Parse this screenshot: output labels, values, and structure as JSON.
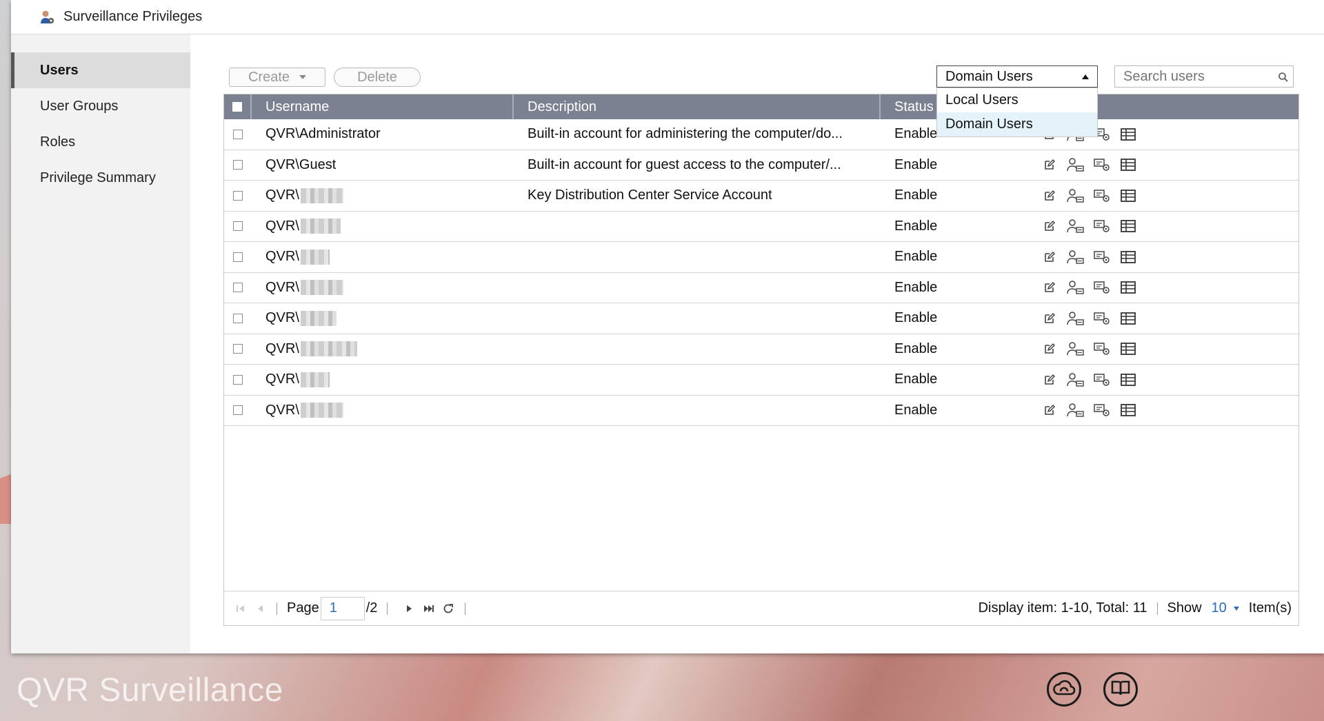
{
  "window": {
    "title": "Surveillance Privileges"
  },
  "sidebar": {
    "items": [
      {
        "label": "Users",
        "active": true
      },
      {
        "label": "User Groups"
      },
      {
        "label": "Roles"
      },
      {
        "label": "Privilege Summary"
      }
    ]
  },
  "toolbar": {
    "create_label": "Create",
    "delete_label": "Delete"
  },
  "filter": {
    "selected": "Domain Users",
    "options": [
      "Local Users",
      "Domain Users"
    ]
  },
  "search": {
    "placeholder": "Search users"
  },
  "table": {
    "columns": [
      "Username",
      "Description",
      "Status"
    ],
    "rows": [
      {
        "username": "QVR\\Administrator",
        "description": "Built-in account for administering the computer/do...",
        "status": "Enable"
      },
      {
        "username": "QVR\\Guest",
        "description": "Built-in account for guest access to the computer/...",
        "status": "Enable"
      },
      {
        "username": "QVR\\",
        "description": "Key Distribution Center Service Account",
        "status": "Enable"
      },
      {
        "username": "QVR\\",
        "description": "",
        "status": "Enable"
      },
      {
        "username": "QVR\\",
        "description": "",
        "status": "Enable"
      },
      {
        "username": "QVR\\",
        "description": "",
        "status": "Enable"
      },
      {
        "username": "QVR\\",
        "description": "",
        "status": "Enable"
      },
      {
        "username": "QVR\\",
        "description": "",
        "status": "Enable"
      },
      {
        "username": "QVR\\",
        "description": "",
        "status": "Enable"
      },
      {
        "username": "QVR\\",
        "description": "",
        "status": "Enable"
      }
    ]
  },
  "pager": {
    "page_label": "Page",
    "page_value": "1",
    "total_pages": "/2",
    "display_info": "Display item: 1-10, Total: 11",
    "show_label": "Show",
    "show_value": "10",
    "items_label": "Item(s)"
  },
  "footer": {
    "brand": "QVR Surveillance"
  }
}
